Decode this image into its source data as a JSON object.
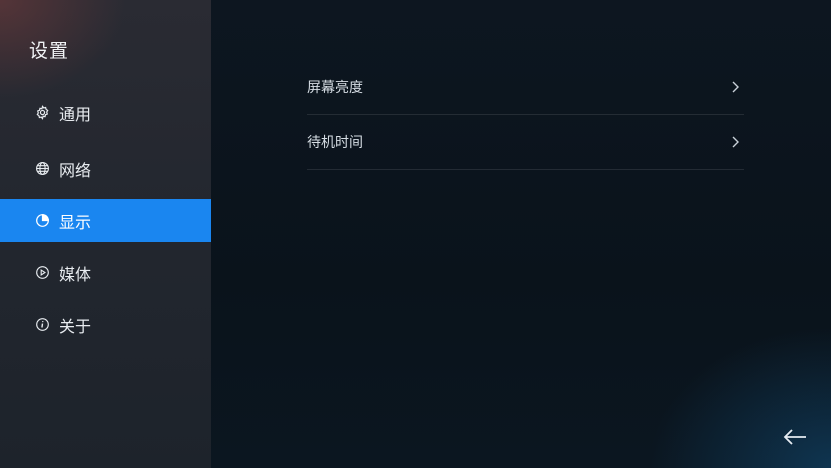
{
  "sidebar": {
    "title": "设置",
    "items": [
      {
        "label": "通用",
        "icon": "gear-icon"
      },
      {
        "label": "网络",
        "icon": "globe-icon"
      },
      {
        "label": "显示",
        "icon": "display-icon",
        "active": true
      },
      {
        "label": "媒体",
        "icon": "play-icon"
      },
      {
        "label": "关于",
        "icon": "info-icon"
      }
    ]
  },
  "main": {
    "rows": [
      {
        "label": "屏幕亮度"
      },
      {
        "label": "待机时间"
      }
    ]
  },
  "colors": {
    "accent": "#1a86f0"
  },
  "footer": {
    "back_icon": "arrow-left-icon"
  }
}
